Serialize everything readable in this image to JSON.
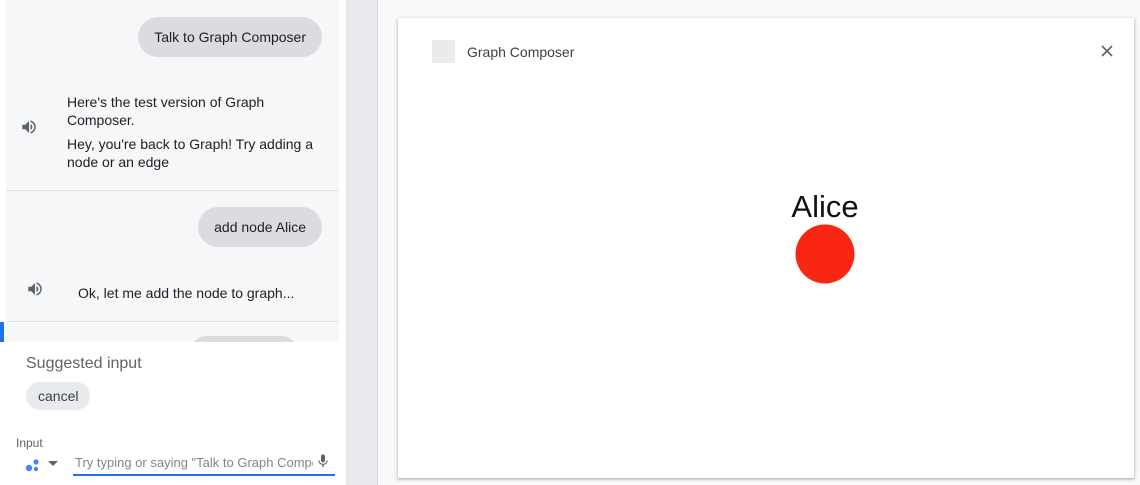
{
  "chat": {
    "messages": [
      {
        "role": "user",
        "text": "Talk to Graph Composer"
      },
      {
        "role": "agent",
        "lines": [
          "Here's the test version of Graph",
          "Composer.",
          "Hey, you're back to Graph! Try adding a",
          "node or an edge"
        ]
      },
      {
        "role": "user",
        "text": "add node Alice"
      },
      {
        "role": "agent",
        "lines": [
          "Ok, let me add the node to graph..."
        ]
      }
    ]
  },
  "suggestions": {
    "title": "Suggested input",
    "chips": [
      "cancel"
    ]
  },
  "input": {
    "label": "Input",
    "placeholder": "Try typing or saying \"Talk to Graph Composer\""
  },
  "app": {
    "title": "Graph Composer",
    "close_icon": "close-icon"
  },
  "graph": {
    "nodes": [
      {
        "label": "Alice",
        "color": "#f92613"
      }
    ]
  }
}
